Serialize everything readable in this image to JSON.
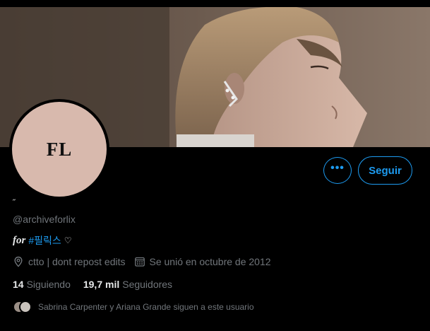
{
  "profile": {
    "avatar_initials": "FL",
    "display_name": "˶",
    "handle": "@archiveforlix",
    "bio": {
      "prefix": "for",
      "hashtag": "#필릭스",
      "suffix": "♡"
    },
    "location": "ctto | dont repost edits",
    "joined": "Se unió en octubre de 2012"
  },
  "actions": {
    "more_label": "•••",
    "follow_label": "Seguir"
  },
  "stats": {
    "following_count": "14",
    "following_label": "Siguiendo",
    "followers_count": "19,7 mil",
    "followers_label": "Seguidores"
  },
  "followed_by": {
    "text": "Sabrina Carpenter y Ariana Grande siguen a este usuario"
  },
  "colors": {
    "accent": "#1d9bf0",
    "background": "#000000",
    "muted": "#71767b",
    "avatar_bg": "#d8b9ad"
  },
  "icons": {
    "location": "location-pin-icon",
    "joined": "calendar-icon"
  }
}
